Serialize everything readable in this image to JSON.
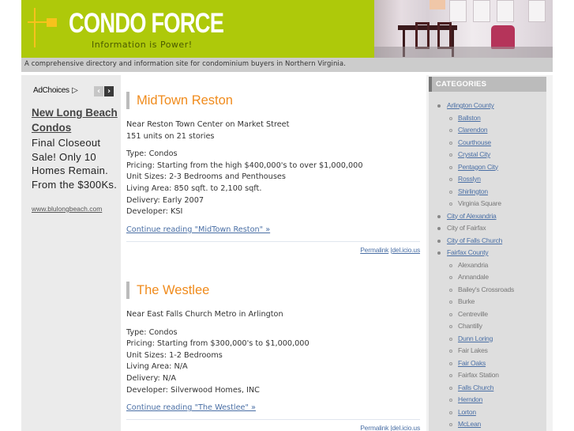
{
  "header": {
    "title": "CONDO FORCE",
    "tagline": "Information is Power!",
    "description": "A comprehensive directory and information site for condominium buyers in Northern Virginia."
  },
  "ad": {
    "adchoices_label": "AdChoices",
    "adchoices_icon": "▷",
    "prev_icon": "‹",
    "next_icon": "›",
    "headline": "New Long Beach Condos",
    "body": "Final Closeout Sale! Only 10 Homes Remain. From the $300Ks.",
    "url": "www.blulongbeach.com"
  },
  "posts": [
    {
      "title": "MidTown Reston",
      "summary": [
        "Near Reston Town Center on Market Street",
        "151 units on 21 stories"
      ],
      "details": [
        "Type: Condos",
        "Pricing: Starting from the high $400,000's to over $1,000,000",
        "Unit Sizes: 2-3 Bedrooms and Penthouses",
        "Living Area: 850 sqft. to 2,100 sqft.",
        "Delivery: Early 2007",
        "Developer: KSI"
      ],
      "continue_label": "Continue reading \"MidTown Reston\" »",
      "permalink_label": "Permalink",
      "separator": "|",
      "delicious_label": "del.icio.us"
    },
    {
      "title": "The Westlee",
      "summary": [
        "Near East Falls Church Metro in Arlington"
      ],
      "details": [
        "Type: Condos",
        "Pricing: Starting from $300,000's to $1,000,000",
        "Unit Sizes: 1-2 Bedrooms",
        "Living Area: N/A",
        "Delivery: N/A",
        "Developer: Silverwood Homes, INC"
      ],
      "continue_label": "Continue reading \"The Westlee\" »",
      "permalink_label": "Permalink",
      "separator": "|",
      "delicious_label": "del.icio.us"
    }
  ],
  "sidebar": {
    "categories_title": "CATEGORIES",
    "categories": [
      {
        "label": "Arlington County",
        "level": "top",
        "link": true
      },
      {
        "label": "Ballston",
        "level": "sub",
        "link": true
      },
      {
        "label": "Clarendon",
        "level": "sub",
        "link": true
      },
      {
        "label": "Courthouse",
        "level": "sub",
        "link": true
      },
      {
        "label": "Crystal City",
        "level": "sub",
        "link": true
      },
      {
        "label": "Pentagon City",
        "level": "sub",
        "link": true
      },
      {
        "label": "Rosslyn",
        "level": "sub",
        "link": true
      },
      {
        "label": "Shirlington",
        "level": "sub",
        "link": true
      },
      {
        "label": "Virginia Square",
        "level": "sub",
        "link": false
      },
      {
        "label": "City of Alexandria",
        "level": "top",
        "link": true
      },
      {
        "label": "City of Fairfax",
        "level": "top",
        "link": false
      },
      {
        "label": "City of Falls Church",
        "level": "top",
        "link": true
      },
      {
        "label": "Fairfax County",
        "level": "top",
        "link": true
      },
      {
        "label": "Alexandria",
        "level": "sub",
        "link": false
      },
      {
        "label": "Annandale",
        "level": "sub",
        "link": false
      },
      {
        "label": "Bailey's Crossroads",
        "level": "sub",
        "link": false
      },
      {
        "label": "Burke",
        "level": "sub",
        "link": false
      },
      {
        "label": "Centreville",
        "level": "sub",
        "link": false
      },
      {
        "label": "Chantilly",
        "level": "sub",
        "link": false
      },
      {
        "label": "Dunn Loring",
        "level": "sub",
        "link": true
      },
      {
        "label": "Fair Lakes",
        "level": "sub",
        "link": false
      },
      {
        "label": "Fair Oaks",
        "level": "sub",
        "link": true
      },
      {
        "label": "Fairfax Station",
        "level": "sub",
        "link": false
      },
      {
        "label": "Falls Church",
        "level": "sub",
        "link": true
      },
      {
        "label": "Herndon",
        "level": "sub",
        "link": true
      },
      {
        "label": "Lorton",
        "level": "sub",
        "link": true
      },
      {
        "label": "McLean",
        "level": "sub",
        "link": true
      }
    ]
  },
  "colors": {
    "header_green": "#aec90a",
    "logo_yellow": "#f7c21c",
    "post_title_orange": "#f08b1c",
    "link_blue": "#4a6fa5"
  }
}
